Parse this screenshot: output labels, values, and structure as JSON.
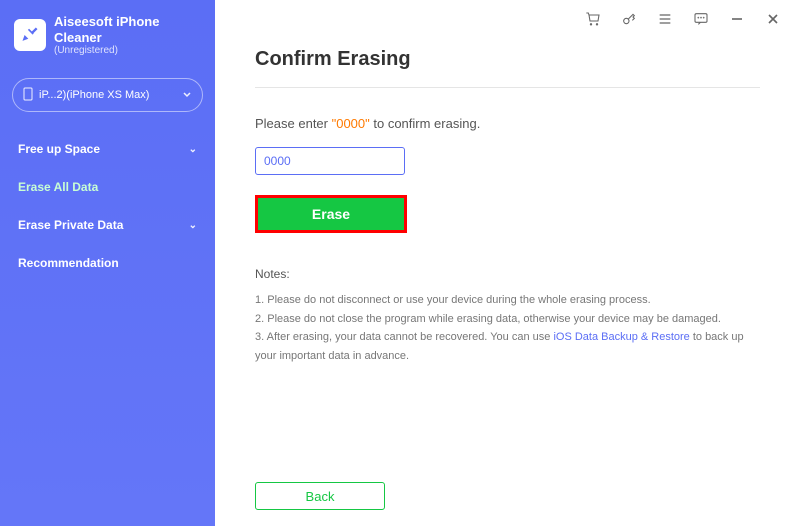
{
  "app": {
    "name": "Aiseesoft iPhone Cleaner",
    "status": "(Unregistered)"
  },
  "device": {
    "label": "iP...2)(iPhone XS Max)"
  },
  "sidebar": {
    "items": [
      {
        "label": "Free up Space",
        "expandable": true
      },
      {
        "label": "Erase All Data",
        "expandable": false,
        "active": true
      },
      {
        "label": "Erase Private Data",
        "expandable": true
      },
      {
        "label": "Recommendation",
        "expandable": false
      }
    ]
  },
  "main": {
    "title": "Confirm Erasing",
    "prompt_prefix": "Please enter ",
    "prompt_code": "\"0000\"",
    "prompt_suffix": " to confirm erasing.",
    "input_value": "0000",
    "erase_label": "Erase",
    "notes_title": "Notes:",
    "notes": [
      "1. Please do not disconnect or use your device during the whole erasing process.",
      "2. Please do not close the program while erasing data, otherwise your device may be damaged."
    ],
    "note3_prefix": "3. After erasing, your data cannot be recovered. You can use ",
    "note3_link": "iOS Data Backup & Restore",
    "note3_suffix": " to back up your important data in advance.",
    "back_label": "Back"
  }
}
